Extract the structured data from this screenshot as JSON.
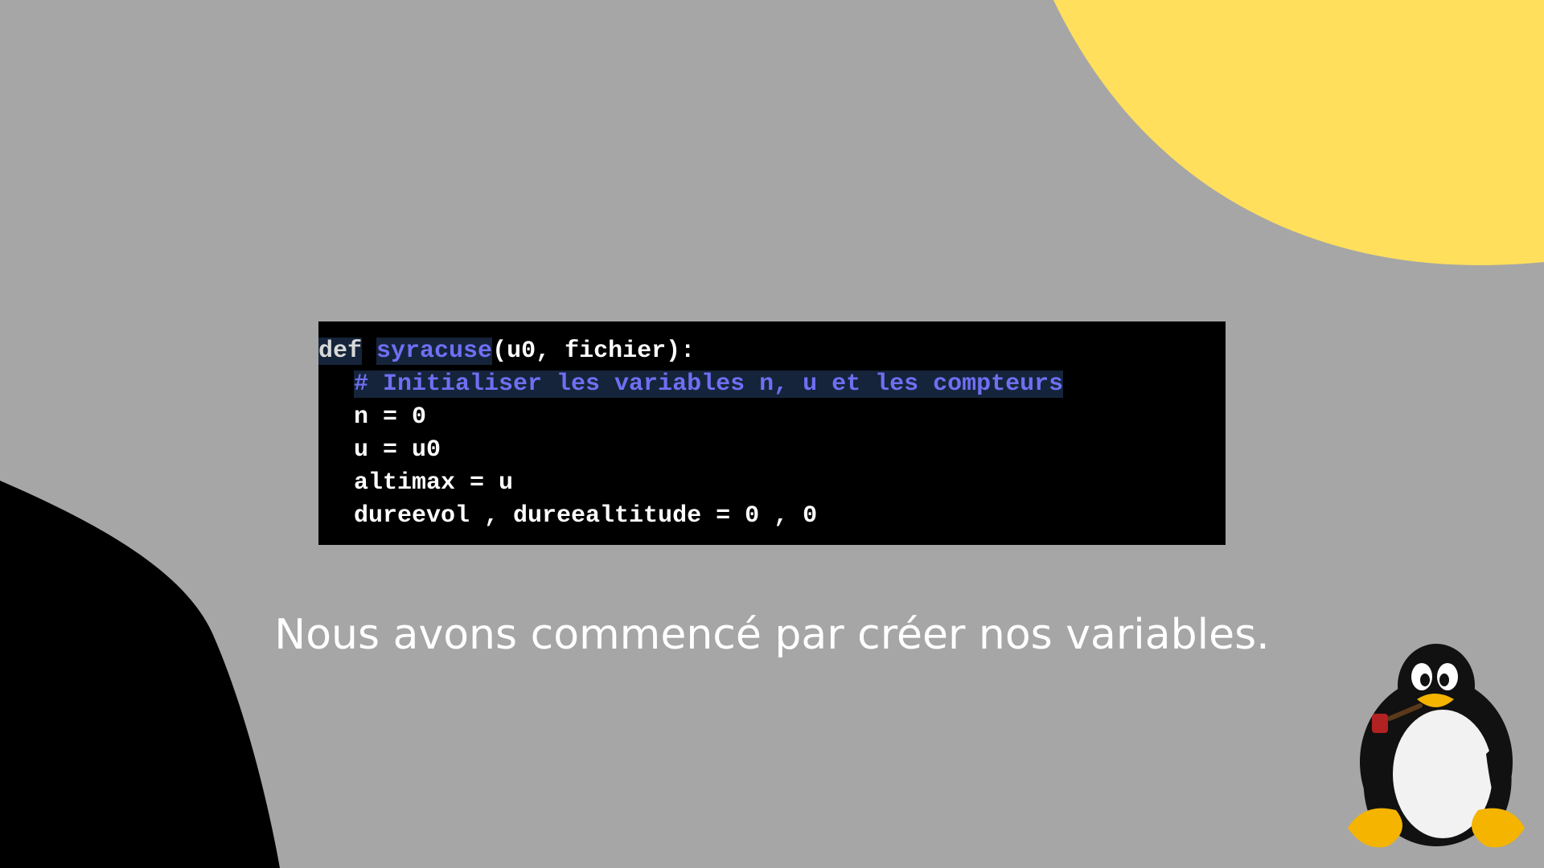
{
  "slide": {
    "colors": {
      "background": "#a6a6a6",
      "accent_yellow": "#ffdf5c",
      "shape_black": "#000000",
      "code_background": "#000000",
      "code_highlight": "#15243a",
      "code_keyword_blue": "#6f6ff3",
      "caption_text": "#ffffff"
    },
    "code": {
      "line1": {
        "keyword": "def",
        "function_name": "syracuse",
        "params": "(u0, fichier):"
      },
      "line2_comment": "# Initialiser les variables n, u et les compteurs",
      "line3": "n = 0",
      "line4": "u = u0",
      "line5": "altimax = u",
      "line6": "dureevol , dureealtitude = 0 , 0"
    },
    "caption": "Nous avons commencé par créer nos variables.",
    "mascot_icon": "tux-penguin-with-pipe-icon"
  }
}
